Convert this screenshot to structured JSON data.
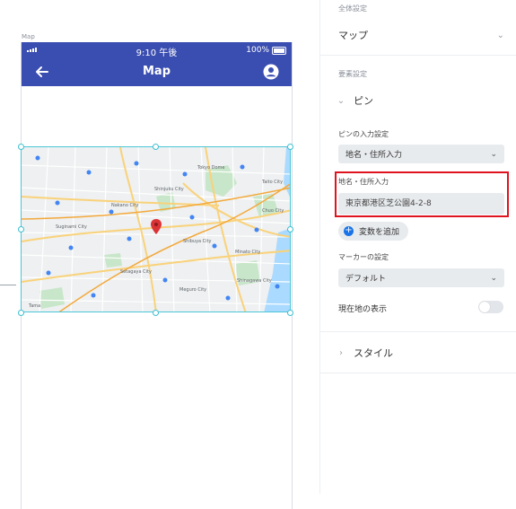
{
  "canvas": {
    "frame_label": "Map",
    "status_bar": {
      "time": "9:10 午後",
      "battery": "100%"
    },
    "app_bar": {
      "title": "Map"
    },
    "map_labels": [
      "Tokyo Dome",
      "Shinjuku City",
      "Shibuya City",
      "Minato City",
      "Meguro City",
      "Setagaya City",
      "Suginami City",
      "Nakano City",
      "Shinagawa City",
      "Chuo City",
      "Taito City",
      "Tama"
    ],
    "colors": {
      "app_bar": "#3a4db0",
      "selection": "#4bc7d6",
      "map_pin": "#db3236"
    }
  },
  "panel": {
    "global_settings_label": "全体設定",
    "screen_type": "マップ",
    "element_settings_label": "要素設定",
    "pin_section": "ピン",
    "pin_input_label": "ピンの入力設定",
    "pin_input_value": "地名・住所入力",
    "address_label": "地名・住所入力",
    "address_value": "東京都港区芝公園4-2-8",
    "add_variable": "変数を追加",
    "marker_label": "マーカーの設定",
    "marker_value": "デフォルト",
    "current_location_label": "現在地の表示",
    "current_location_enabled": false,
    "style_section": "スタイル",
    "colors": {
      "highlight_border": "#e0141e",
      "add_variable_icon": "#1a73e8"
    }
  }
}
